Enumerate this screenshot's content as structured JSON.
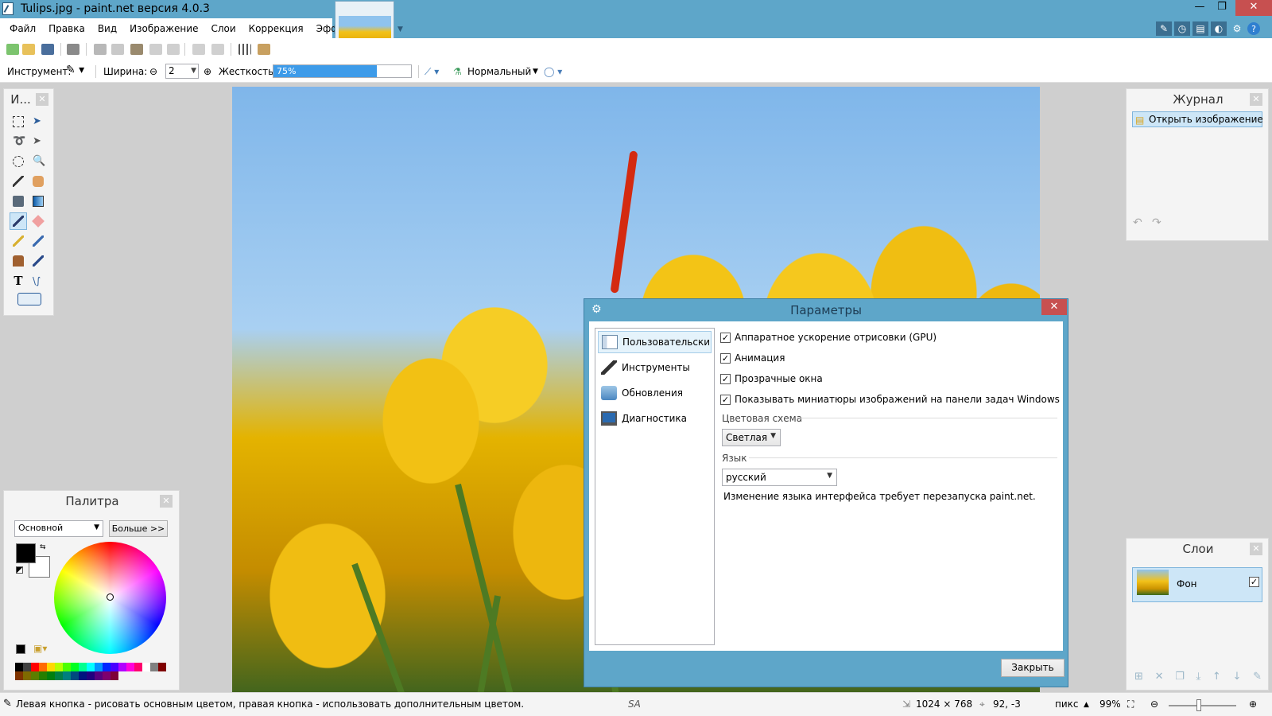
{
  "window": {
    "title": "Tulips.jpg - paint.net версия 4.0.3"
  },
  "menu": [
    "Файл",
    "Правка",
    "Вид",
    "Изображение",
    "Слои",
    "Коррекция",
    "Эффекты"
  ],
  "tool_options": {
    "tool_label": "Инструмент:",
    "width_label": "Ширина:",
    "width_value": "2",
    "hardness_label": "Жесткость:",
    "hardness_value": "75%",
    "hardness_fraction": 0.75,
    "blend_mode": "Нормальный"
  },
  "tools_panel": {
    "title": "И..."
  },
  "palette_panel": {
    "title": "Палитра",
    "palette_select": "Основной",
    "more_button": "Больше >>",
    "primary_color": "#000000",
    "secondary_color": "#ffffff",
    "swatches": [
      "#000000",
      "#404040",
      "#ff0000",
      "#ff6a00",
      "#ffd800",
      "#b6ff00",
      "#4cff00",
      "#00ff21",
      "#00ff90",
      "#00ffff",
      "#0094ff",
      "#0026ff",
      "#4800ff",
      "#b200ff",
      "#ff00dc",
      "#ff006e",
      "#ffffff",
      "#808080",
      "#7f0000",
      "#7f3300",
      "#7f6a00",
      "#5b7f00",
      "#267f00",
      "#007f0e",
      "#007f46",
      "#007f7f",
      "#004a7f",
      "#00137f",
      "#21007f",
      "#57007f",
      "#7f006e",
      "#7f0037"
    ]
  },
  "history_panel": {
    "title": "Журнал",
    "items": [
      "Открыть изображение"
    ]
  },
  "layers_panel": {
    "title": "Слои",
    "layers": [
      {
        "name": "Фон",
        "visible": true
      }
    ]
  },
  "dialog": {
    "title": "Параметры",
    "nav": [
      {
        "label": "Пользовательский интерфейс",
        "icon": "ui-window-icon",
        "active": true
      },
      {
        "label": "Инструменты",
        "icon": "tools-icon",
        "active": false
      },
      {
        "label": "Обновления",
        "icon": "update-icon",
        "active": false
      },
      {
        "label": "Диагностика",
        "icon": "monitor-icon",
        "active": false
      }
    ],
    "checkboxes": [
      {
        "label": "Аппаратное ускорение отрисовки (GPU)",
        "checked": true
      },
      {
        "label": "Анимация",
        "checked": true
      },
      {
        "label": "Прозрачные окна",
        "checked": true
      },
      {
        "label": "Показывать миниатюры изображений на панели задач Windows",
        "checked": true
      }
    ],
    "color_scheme_label": "Цветовая схема",
    "color_scheme_value": "Светлая",
    "language_label": "Язык",
    "language_value": "русский",
    "language_note": "Изменение языка интерфейса требует перезапуска paint.net.",
    "close_button": "Закрыть"
  },
  "status": {
    "hint": "Левая кнопка - рисовать основным цветом, правая кнопка - использовать дополнительным цветом.",
    "image_size": "1024 × 768",
    "cursor_pos": "92, -3",
    "units": "пикс",
    "zoom": "99%"
  },
  "colors": {
    "chrome": "#5ea6c9",
    "selection": "#cde6f7",
    "close": "#c75050"
  }
}
